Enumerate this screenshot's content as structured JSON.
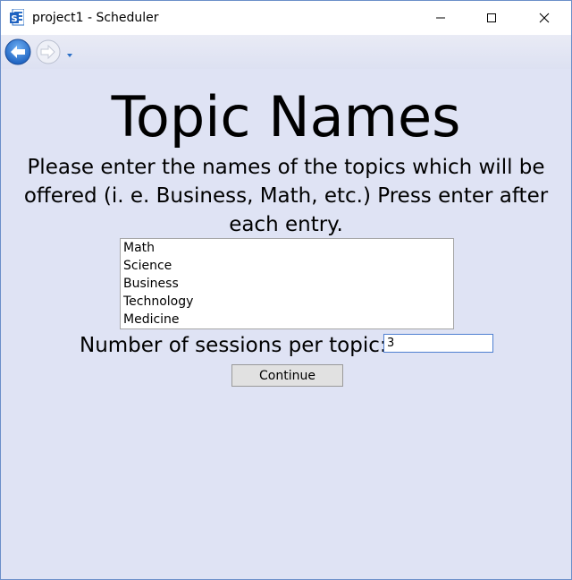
{
  "window": {
    "title": "project1 - Scheduler"
  },
  "page": {
    "title": "Topic Names",
    "instructions": "Please enter the names of the topics which will be offered (i. e. Business, Math, etc.) Press enter after each entry."
  },
  "topics": [
    "Math",
    "Science",
    "Business",
    "Technology",
    "Medicine"
  ],
  "sessions": {
    "label": "Number of sessions per topic:",
    "value": "3"
  },
  "continue_label": "Continue",
  "icons": {
    "app": "sheet-app-icon",
    "back": "back-arrow-icon",
    "forward": "forward-arrow-icon",
    "dropdown": "chevron-down-icon"
  },
  "colors": {
    "content_background": "#dfe3f4",
    "accent": "#2b6fc6"
  }
}
